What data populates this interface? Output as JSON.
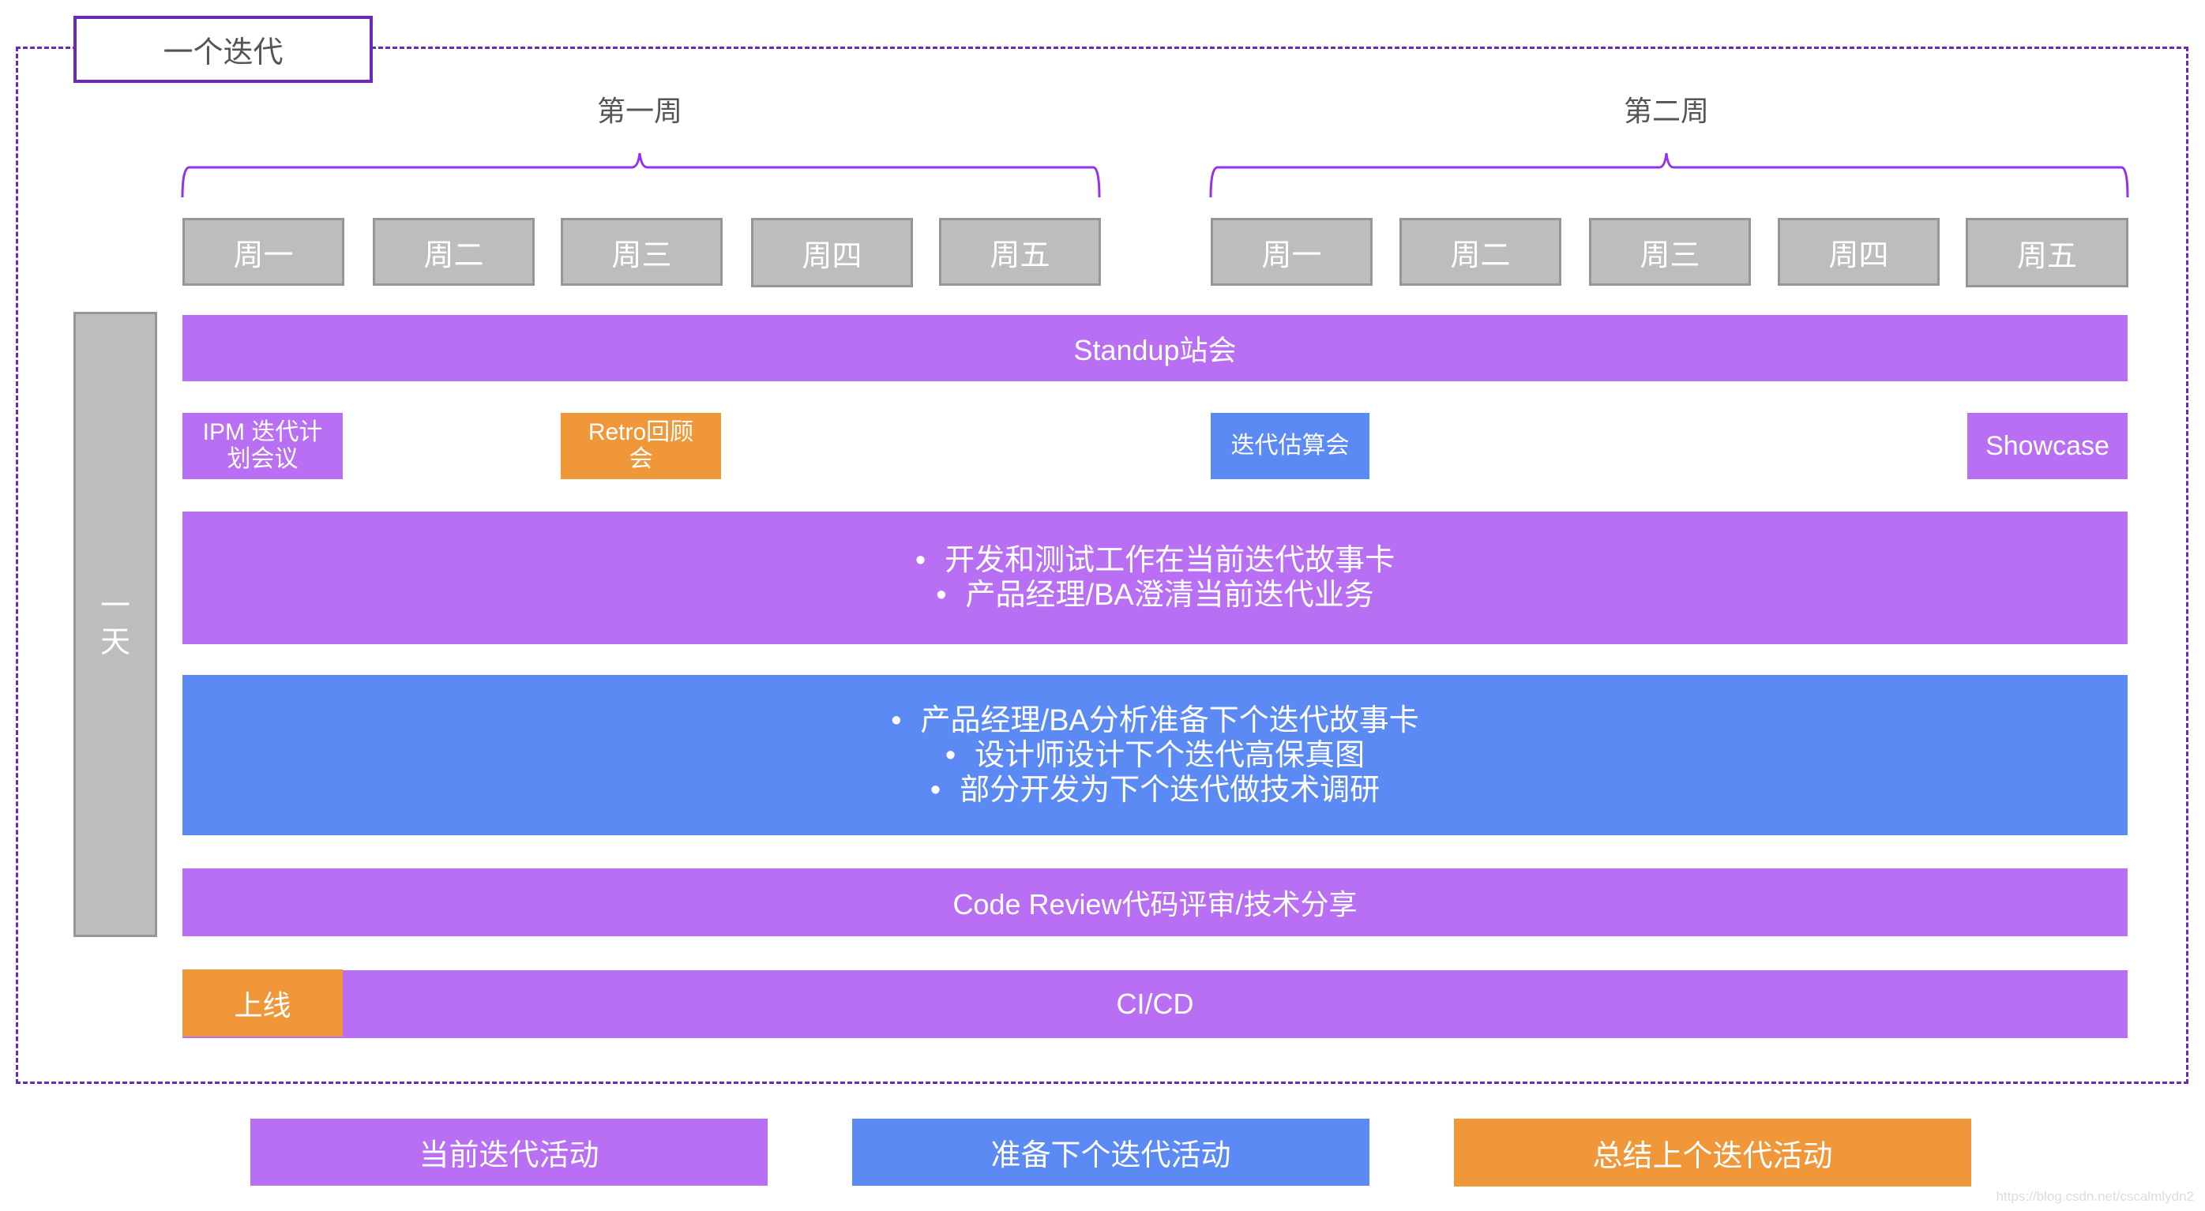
{
  "title": "一个迭代",
  "weeks": [
    {
      "label": "第一周",
      "days": [
        "周一",
        "周二",
        "周三",
        "周四",
        "周五"
      ]
    },
    {
      "label": "第二周",
      "days": [
        "周一",
        "周二",
        "周三",
        "周四",
        "周五"
      ]
    }
  ],
  "left_label": "一\n天",
  "rows": {
    "standup": "Standup站会",
    "meetings": {
      "ipm": "IPM 迭代计划会议",
      "retro": "Retro回顾会",
      "estimation": "迭代估算会",
      "showcase": "Showcase"
    },
    "current_work": [
      "开发和测试工作在当前迭代故事卡",
      "产品经理/BA澄清当前迭代业务"
    ],
    "next_prep": [
      "产品经理/BA分析准备下个迭代故事卡",
      "设计师设计下个迭代高保真图",
      "部分开发为下个迭代做技术调研"
    ],
    "code_review": "Code Review代码评审/技术分享",
    "release": "上线",
    "cicd": "CI/CD"
  },
  "legend": [
    {
      "label": "当前迭代活动",
      "color": "#b86ff4"
    },
    {
      "label": "准备下个迭代活动",
      "color": "#5b8af5"
    },
    {
      "label": "总结上个迭代活动",
      "color": "#f0973a"
    }
  ],
  "colors": {
    "current": "#b86ff4",
    "next": "#5b8af5",
    "previous": "#f0973a",
    "border": "#6a2bb8",
    "day_box": "#bdbdbd"
  },
  "watermark": "https://blog.csdn.net/cscalmlydn2"
}
